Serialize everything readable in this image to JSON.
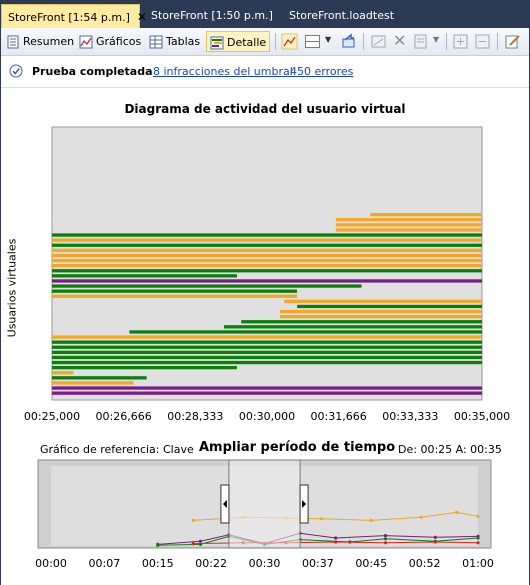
{
  "tabs": [
    {
      "label": "StoreFront [1:54 p.m.]",
      "active": true
    },
    {
      "label": "StoreFront [1:50 p.m.]",
      "active": false
    },
    {
      "label": "StoreFront.loadtest",
      "active": false
    }
  ],
  "toolbar": {
    "summary_label": "Resumen",
    "graphs_label": "Gráficos",
    "tables_label": "Tablas",
    "detail_label": "Detalle"
  },
  "infobar": {
    "status": "Prueba completada",
    "violations_link": "8 infracciones del umbral",
    "errors_link": "450 errores"
  },
  "chart": {
    "title": "Diagrama de actividad del usuario virtual",
    "ylabel": "Usuarios virtuales"
  },
  "zoom": {
    "reference_label": "Gráfico de referencia: Clave",
    "title": "Ampliar período de tiempo",
    "range_label": "De: 00:25 A: 00:35"
  },
  "colors": {
    "orange": "#f5a623",
    "green": "#0a7f0a",
    "purple": "#7b1a8a",
    "plot_bg": "#e0e0e0"
  },
  "chart_data": [
    {
      "type": "gantt",
      "title": "Diagrama de actividad del usuario virtual",
      "ylabel": "Usuarios virtuales",
      "xlabel": "",
      "x_ticks": [
        "00:25,000",
        "00:26,666",
        "00:28,333",
        "00:30,000",
        "00:31,666",
        "00:33,333",
        "00:35,000"
      ],
      "xlim": [
        25.0,
        35.0
      ],
      "bars": [
        {
          "start": 32.4,
          "end": 35.0,
          "color": "orange"
        },
        {
          "start": 31.6,
          "end": 35.0,
          "color": "orange"
        },
        {
          "start": 31.6,
          "end": 35.0,
          "color": "orange"
        },
        {
          "start": 31.6,
          "end": 35.0,
          "color": "orange"
        },
        {
          "start": 25.0,
          "end": 35.0,
          "color": "green"
        },
        {
          "start": 25.0,
          "end": 35.0,
          "color": "orange"
        },
        {
          "start": 25.0,
          "end": 35.0,
          "color": "green"
        },
        {
          "start": 25.0,
          "end": 35.0,
          "color": "orange"
        },
        {
          "start": 25.0,
          "end": 35.0,
          "color": "orange"
        },
        {
          "start": 25.0,
          "end": 35.0,
          "color": "orange"
        },
        {
          "start": 25.0,
          "end": 35.0,
          "color": "orange"
        },
        {
          "start": 25.0,
          "end": 35.0,
          "color": "green"
        },
        {
          "start": 25.0,
          "end": 29.3,
          "color": "green"
        },
        {
          "start": 25.0,
          "end": 35.0,
          "color": "purple"
        },
        {
          "start": 25.0,
          "end": 32.2,
          "color": "green"
        },
        {
          "start": 25.0,
          "end": 30.7,
          "color": "green"
        },
        {
          "start": 25.0,
          "end": 30.7,
          "color": "orange"
        },
        {
          "start": 30.4,
          "end": 35.0,
          "color": "orange"
        },
        {
          "start": 30.7,
          "end": 35.0,
          "color": "green"
        },
        {
          "start": 30.3,
          "end": 35.0,
          "color": "orange"
        },
        {
          "start": 30.3,
          "end": 35.0,
          "color": "orange"
        },
        {
          "start": 29.4,
          "end": 35.0,
          "color": "green"
        },
        {
          "start": 29.0,
          "end": 35.0,
          "color": "green"
        },
        {
          "start": 26.8,
          "end": 35.0,
          "color": "green"
        },
        {
          "start": 25.0,
          "end": 35.0,
          "color": "orange"
        },
        {
          "start": 25.0,
          "end": 35.0,
          "color": "green"
        },
        {
          "start": 25.0,
          "end": 35.0,
          "color": "green"
        },
        {
          "start": 25.0,
          "end": 35.0,
          "color": "green"
        },
        {
          "start": 25.0,
          "end": 35.0,
          "color": "green"
        },
        {
          "start": 25.0,
          "end": 35.0,
          "color": "green"
        },
        {
          "start": 25.0,
          "end": 29.3,
          "color": "green"
        },
        {
          "start": 25.0,
          "end": 25.5,
          "color": "orange"
        },
        {
          "start": 25.0,
          "end": 27.2,
          "color": "green"
        },
        {
          "start": 25.0,
          "end": 26.9,
          "color": "orange"
        },
        {
          "start": 25.0,
          "end": 35.0,
          "color": "purple"
        },
        {
          "start": 25.0,
          "end": 35.0,
          "color": "purple"
        }
      ]
    },
    {
      "type": "line",
      "title": "Ampliar período de tiempo",
      "x_ticks": [
        "00:00",
        "00:07",
        "00:15",
        "00:22",
        "00:30",
        "00:37",
        "00:45",
        "00:52",
        "01:00"
      ],
      "xlim": [
        0,
        60
      ],
      "ylim": [
        0,
        10
      ],
      "selection": [
        25,
        35
      ],
      "series": [
        {
          "color": "#f5a623",
          "x": [
            20,
            27,
            33,
            38,
            45,
            52,
            57,
            60
          ],
          "y": [
            3.2,
            3.6,
            3.5,
            3.4,
            3.2,
            3.6,
            4.2,
            3.7
          ]
        },
        {
          "color": "#7b1a8a",
          "x": [
            15,
            21,
            25,
            30,
            35,
            40,
            47,
            54,
            60
          ],
          "y": [
            0.2,
            0.6,
            1.4,
            0.3,
            1.6,
            1.0,
            1.3,
            1.1,
            1.2
          ]
        },
        {
          "color": "#0a7f0a",
          "x": [
            15,
            21,
            25,
            30,
            35,
            42,
            47,
            54,
            60
          ],
          "y": [
            0.1,
            0.2,
            1.2,
            0.2,
            0.8,
            0.5,
            0.9,
            0.6,
            1.0
          ]
        },
        {
          "color": "#e02020",
          "x": [
            20,
            27,
            33,
            40,
            47,
            54,
            60
          ],
          "y": [
            0.3,
            0.4,
            0.4,
            0.5,
            0.4,
            0.5,
            0.4
          ]
        }
      ]
    }
  ]
}
